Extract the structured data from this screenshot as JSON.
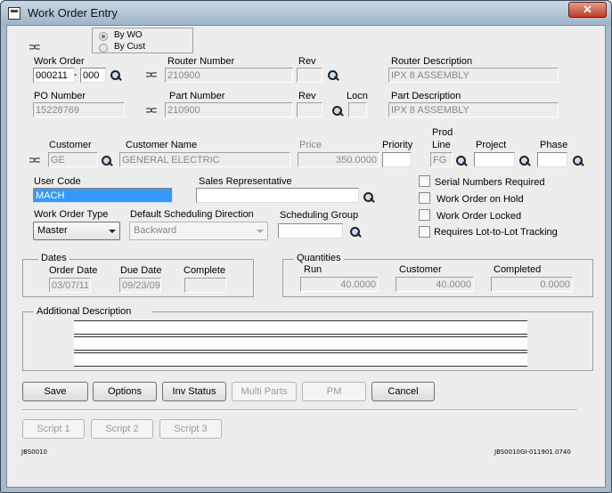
{
  "window": {
    "title": "Work Order Entry",
    "close_glyph": "✕"
  },
  "lookup_mode": {
    "options": [
      {
        "label": "By WO",
        "selected": true
      },
      {
        "label": "By Cust",
        "selected": false
      }
    ]
  },
  "labels": {
    "work_order": "Work Order",
    "router_number": "Router Number",
    "rev": "Rev",
    "router_description": "Router Description",
    "po_number": "PO Number",
    "part_number": "Part Number",
    "locn": "Locn",
    "part_description": "Part Description",
    "customer": "Customer",
    "customer_name": "Customer Name",
    "price": "Price",
    "priority": "Priority",
    "prod_line_1": "Prod",
    "prod_line_2": "Line",
    "project": "Project",
    "phase": "Phase",
    "user_code": "User Code",
    "sales_rep": "Sales Representative",
    "work_order_type": "Work Order Type",
    "default_sched_dir": "Default Scheduling Direction",
    "sched_group": "Scheduling Group"
  },
  "fields": {
    "work_order": "000211",
    "wo_separator": "-",
    "work_order_suffix": "000",
    "router_number": "210900",
    "router_rev": "",
    "router_description": "IPX 8 ASSEMBLY",
    "po_number": "15228769",
    "part_number": "210900",
    "part_rev": "",
    "locn": "",
    "part_description": "IPX 8 ASSEMBLY",
    "customer": "GE",
    "customer_name": "GENERAL ELECTRIC",
    "price": "350.0000",
    "priority": "",
    "prod_line": "FG",
    "project": "",
    "phase": "",
    "user_code": "MACH",
    "sales_rep": "",
    "work_order_type": "Master",
    "default_sched_dir": "Backward",
    "sched_group": ""
  },
  "checkboxes": [
    {
      "label": "Serial Numbers Required",
      "checked": false
    },
    {
      "label": "Work Order on Hold",
      "checked": false
    },
    {
      "label": "Work Order Locked",
      "checked": false
    },
    {
      "label": "Requires Lot-to-Lot Tracking",
      "checked": false
    }
  ],
  "dates": {
    "title": "Dates",
    "order_date_label": "Order Date",
    "due_date_label": "Due Date",
    "complete_label": "Complete",
    "order_date": "03/07/11",
    "due_date": "09/23/09",
    "complete": ""
  },
  "quantities": {
    "title": "Quantities",
    "run_label": "Run",
    "customer_label": "Customer",
    "completed_label": "Completed",
    "run": "40.0000",
    "customer": "40.0000",
    "completed": "0.0000"
  },
  "additional_description": {
    "title": "Additional Description",
    "lines": [
      "",
      "",
      ""
    ]
  },
  "buttons": {
    "save": "Save",
    "options": "Options",
    "inv_status": "Inv Status",
    "multi_parts": "Multi Parts",
    "pm": "PM",
    "cancel": "Cancel",
    "script1": "Script 1",
    "script2": "Script 2",
    "script3": "Script 3"
  },
  "footer": {
    "left_code": "JBS0010",
    "right_code": "JBS0010GI-011901.0740"
  },
  "icons": {
    "lookup": "magnifier-icon",
    "link": "link-icon"
  }
}
